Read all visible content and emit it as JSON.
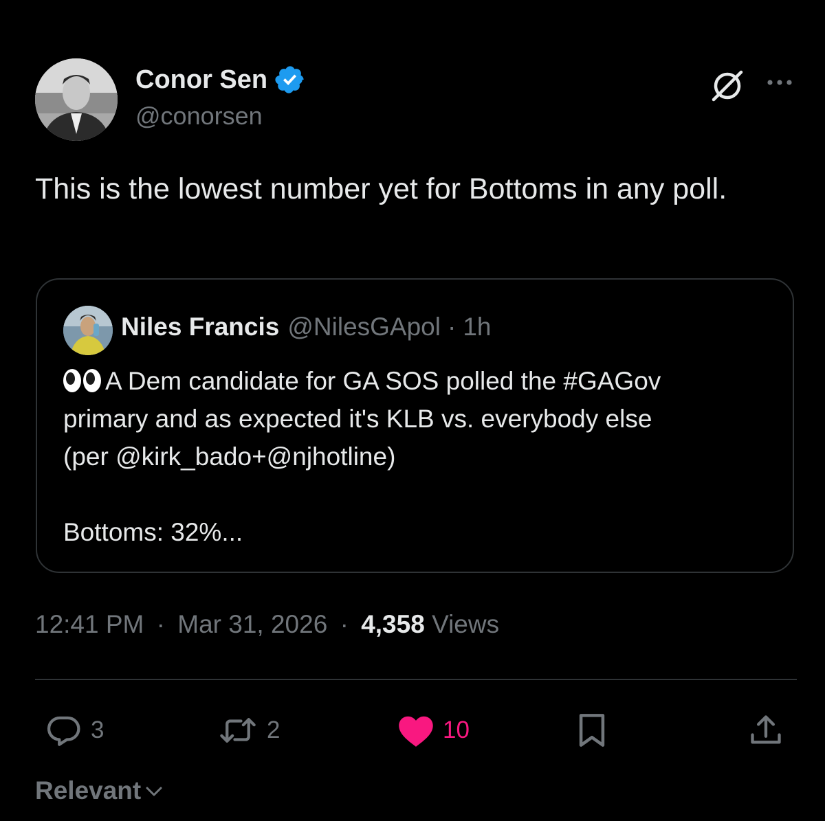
{
  "author": {
    "name": "Conor Sen",
    "handle": "@conorsen"
  },
  "tweet": {
    "text": "This is the lowest number yet for Bottoms in any poll."
  },
  "quoted": {
    "name": "Niles Francis",
    "handle": "@NilesGApol",
    "separator": "·",
    "time": "1h",
    "emoji": "eyes",
    "body_line1": "A Dem candidate for GA SOS polled the #GAGov",
    "body_line2": "primary and as expected it's KLB vs. everybody else",
    "body_line3": "(per @kirk_bado+@njhotline)",
    "body_line4": "Bottoms: 32%..."
  },
  "meta": {
    "time": "12:41 PM",
    "sep1": "·",
    "date": "Mar 31, 2026",
    "sep2": "·",
    "views_count": "4,358",
    "views_label": "Views"
  },
  "actions": {
    "replies": "3",
    "reposts": "2",
    "likes": "10"
  },
  "colors": {
    "background": "#000000",
    "text": "#e7e9ea",
    "muted": "#71767b",
    "verified": "#1d9bf0",
    "like": "#f91880",
    "border": "#2f3336"
  },
  "sort": {
    "label": "Relevant"
  }
}
